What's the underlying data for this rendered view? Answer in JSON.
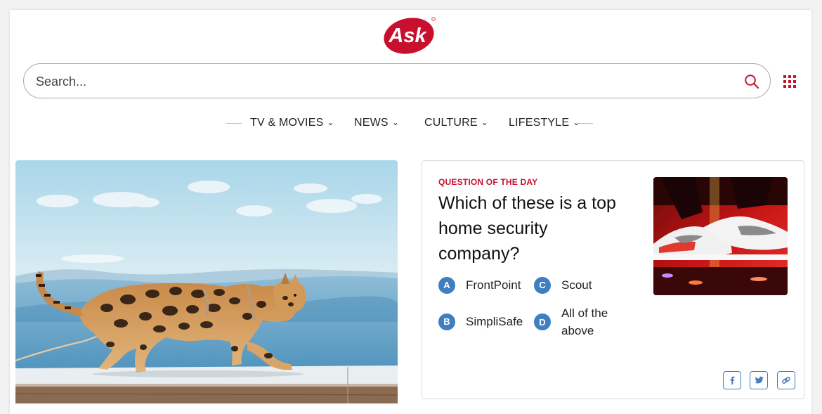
{
  "brand": {
    "name": "Ask",
    "color": "#c8102e"
  },
  "search": {
    "placeholder": "Search...",
    "value": "",
    "icon": "search-icon"
  },
  "apps_icon": "grid-icon",
  "nav": {
    "items": [
      {
        "label": "TV & MOVIES",
        "icon": "chevron-down-icon"
      },
      {
        "label": "NEWS",
        "icon": "chevron-down-icon"
      },
      {
        "label": "CULTURE",
        "icon": "chevron-down-icon"
      },
      {
        "label": "LIFESTYLE",
        "icon": "chevron-down-icon"
      }
    ]
  },
  "hero": {
    "image": "bengal-cat-walking-on-ledge"
  },
  "question_card": {
    "kicker": "QUESTION OF THE DAY",
    "question": "Which of these is a top home security company?",
    "options": [
      {
        "letter": "A",
        "text": "FrontPoint"
      },
      {
        "letter": "B",
        "text": "SimpliSafe"
      },
      {
        "letter": "C",
        "text": "Scout"
      },
      {
        "letter": "D",
        "text": "All of the above"
      }
    ],
    "image": "sneakers-on-stage",
    "accent": "#3f7fc1",
    "share": [
      "facebook-icon",
      "twitter-icon",
      "link-icon"
    ]
  }
}
